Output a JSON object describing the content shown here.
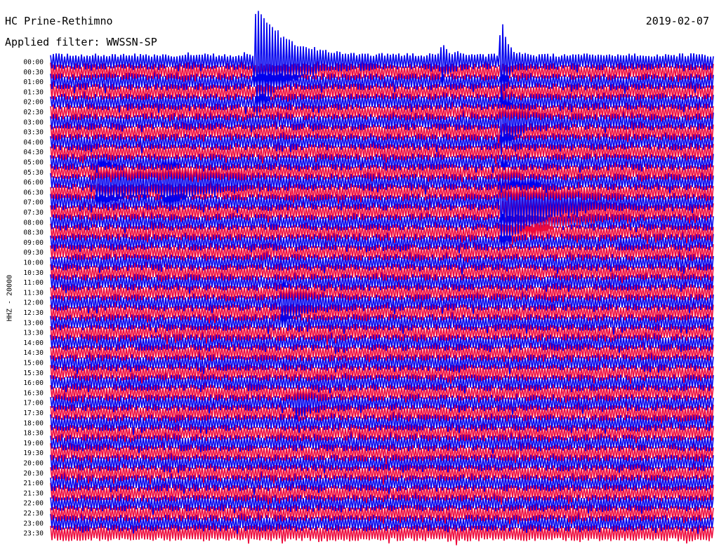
{
  "header": {
    "station": "HC Prine-Rethimno",
    "filter": "Applied filter: WWSSN-SP",
    "date": "2019-02-07"
  },
  "side_label": "HHZ - 20000",
  "colors": {
    "even_rows": "#0000ee",
    "odd_rows": "#ee0a3c",
    "background": "#ffffff"
  },
  "chart_data": {
    "type": "line",
    "title": "HC Prine-Rethimno",
    "ylabel": "HHZ - 20000",
    "row_labels": [
      "00:00",
      "00:30",
      "01:00",
      "01:30",
      "02:00",
      "02:30",
      "03:00",
      "03:30",
      "04:00",
      "04:30",
      "05:00",
      "05:30",
      "06:00",
      "06:30",
      "07:00",
      "07:30",
      "08:00",
      "08:30",
      "09:00",
      "09:30",
      "10:00",
      "10:30",
      "11:00",
      "11:30",
      "12:00",
      "12:30",
      "13:00",
      "13:30",
      "14:00",
      "14:30",
      "15:00",
      "15:30",
      "16:00",
      "16:30",
      "17:00",
      "17:30",
      "18:00",
      "18:30",
      "19:00",
      "19:30",
      "20:00",
      "20:30",
      "21:00",
      "21:30",
      "22:00",
      "22:30",
      "23:00",
      "23:30"
    ],
    "row_minutes": 30,
    "events": [
      {
        "row": 0,
        "t_frac": 0.31,
        "amplitude": 5.0,
        "width": 0.04,
        "color_row": "blue"
      },
      {
        "row": 0,
        "t_frac": 0.59,
        "amplitude": 1.2,
        "width": 0.01
      },
      {
        "row": 0,
        "t_frac": 0.68,
        "amplitude": 4.0,
        "width": 0.008
      },
      {
        "row": 6,
        "t_frac": 0.68,
        "amplitude": 2.5,
        "width": 0.02
      },
      {
        "row": 14,
        "t_frac": 0.68,
        "amplitude": 4.0,
        "width": 0.05
      },
      {
        "row": 15,
        "t_frac": 0.69,
        "amplitude": 3.0,
        "width": 0.06
      },
      {
        "row": 12,
        "t_frac": 0.07,
        "amplitude": 1.8,
        "width": 0.06
      },
      {
        "row": 12,
        "t_frac": 0.17,
        "amplitude": 1.5,
        "width": 0.05
      },
      {
        "row": 24,
        "t_frac": 0.35,
        "amplitude": 1.5,
        "width": 0.03
      },
      {
        "row": 34,
        "t_frac": 0.37,
        "amplitude": 1.0,
        "width": 0.02
      }
    ]
  }
}
